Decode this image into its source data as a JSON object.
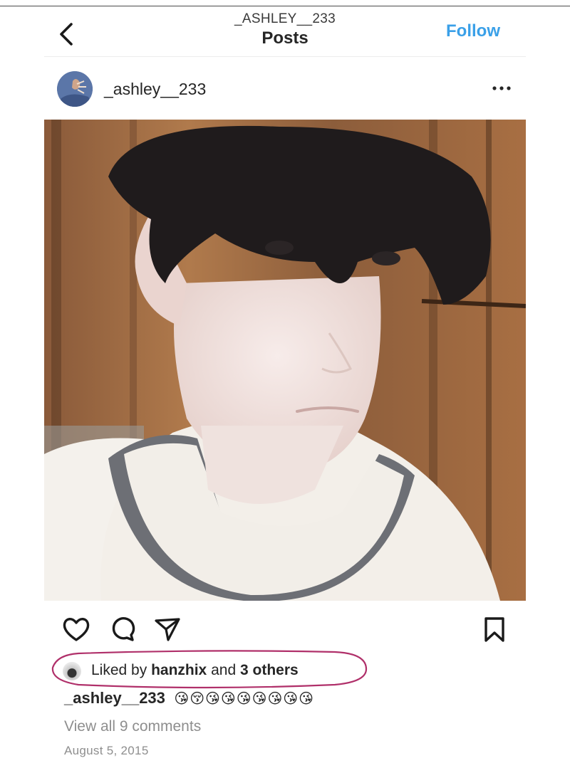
{
  "header": {
    "account_handle": "_ASHLEY__233",
    "title": "Posts",
    "follow_label": "Follow",
    "back_icon": "chevron-left-icon"
  },
  "post": {
    "username": "_ashley__233",
    "more_icon": "ellipsis-icon",
    "photo": "selfie of a young man with dark fringe hair in a light t-shirt, wooden wall background",
    "actions": [
      "heart-icon",
      "comment-icon",
      "share-icon",
      "bookmark-icon"
    ],
    "likes": {
      "prefix": "Liked by",
      "liker": "hanzhix",
      "joiner": "and",
      "others": "3 others",
      "highlight_color": "#b0306a"
    },
    "caption": {
      "username": "_ashley__233",
      "emojis": "😘😚😘😘😘😘😘😘😘"
    },
    "view_comments": "View all 9 comments",
    "date": "August 5, 2015"
  },
  "colors": {
    "accent": "#3aa0e8",
    "muted_text": "#8e8e8e",
    "text": "#262626"
  }
}
